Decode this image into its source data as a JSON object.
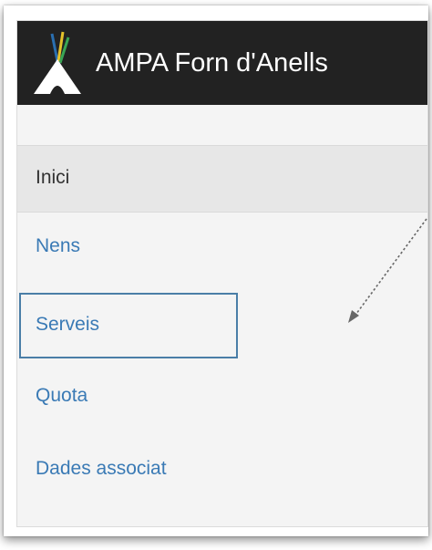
{
  "brand": {
    "title": "AMPA Forn d'Anells",
    "logo_icon": "tent-with-feathers-icon"
  },
  "nav": {
    "items": [
      {
        "label": "Inici",
        "state": "active"
      },
      {
        "label": "Nens",
        "state": "normal"
      },
      {
        "label": "Serveis",
        "state": "highlighted"
      },
      {
        "label": "Quota",
        "state": "normal"
      },
      {
        "label": "Dades associat",
        "state": "normal"
      }
    ]
  },
  "colors": {
    "brand_bar": "#222222",
    "link": "#3a7ab5",
    "active_bg": "#e7e7e7",
    "highlight_border": "#4a7ea7",
    "panel_bg": "#f4f4f4"
  },
  "annotation": {
    "icon": "dotted-arrow-icon",
    "points_to": "Serveis"
  }
}
